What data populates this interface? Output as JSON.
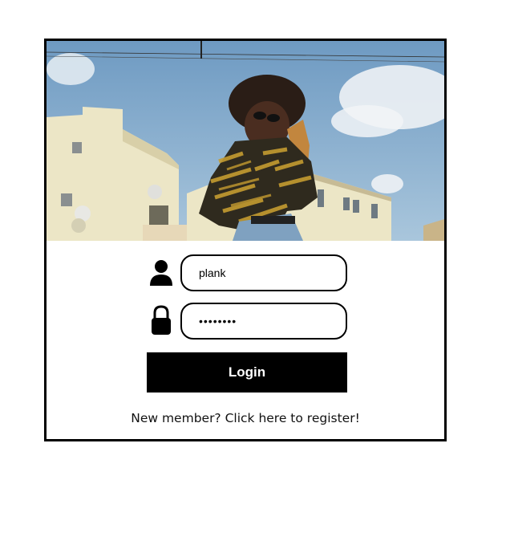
{
  "login_form": {
    "username_value": "plank",
    "password_value": "password",
    "login_label": "Login",
    "register_text": "New member? Click here to register!"
  },
  "icons": {
    "username": "user-icon",
    "password": "lock-icon"
  },
  "colors": {
    "border": "#000000",
    "button_bg": "#000000",
    "button_text": "#ffffff",
    "background": "#ffffff"
  }
}
